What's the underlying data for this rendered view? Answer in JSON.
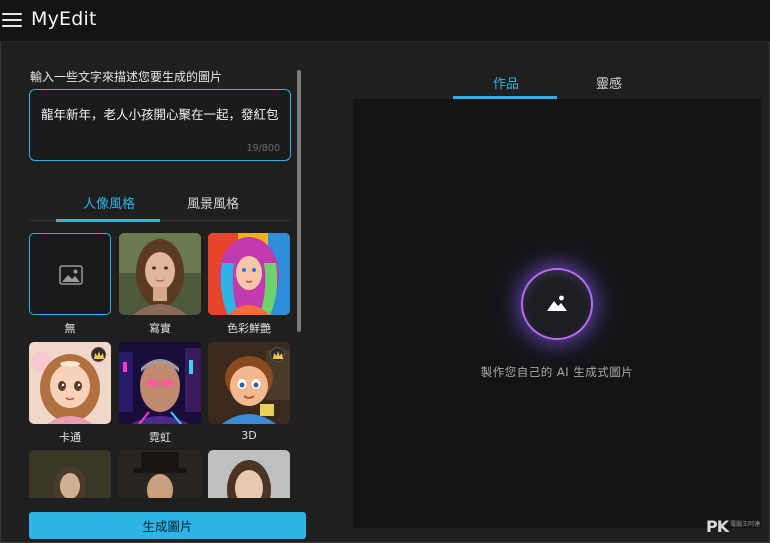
{
  "header": {
    "title": "MyEdit"
  },
  "prompt": {
    "label": "輸入一些文字來描述您要生成的圖片",
    "value": "龍年新年，老人小孩開心聚在一起，發紅包",
    "counter": "19/800"
  },
  "style_tabs": {
    "portrait": "人像風格",
    "landscape": "風景風格",
    "active": "portrait"
  },
  "styles": [
    {
      "label": "無",
      "selected": true,
      "premium": false
    },
    {
      "label": "寫實",
      "selected": false,
      "premium": false
    },
    {
      "label": "色彩鮮艷",
      "selected": false,
      "premium": false
    },
    {
      "label": "卡通",
      "selected": false,
      "premium": true
    },
    {
      "label": "霓虹",
      "selected": false,
      "premium": false
    },
    {
      "label": "3D",
      "selected": false,
      "premium": true
    }
  ],
  "generate_button": "生成圖片",
  "result_tabs": {
    "works": "作品",
    "inspiration": "靈感",
    "active": "works"
  },
  "preview": {
    "caption": "製作您自己的 AI 生成式圖片"
  },
  "watermark": {
    "brand": "PK",
    "subtext": "電腦王阿達"
  },
  "colors": {
    "accent": "#2fb4e8",
    "background": "#1f1f1f",
    "header": "#131313",
    "orb_glow": "#b86cf0"
  },
  "icons": {
    "menu": "hamburger-icon",
    "none_style": "image-placeholder-icon",
    "premium": "crown-icon",
    "preview": "mountain-image-icon"
  }
}
